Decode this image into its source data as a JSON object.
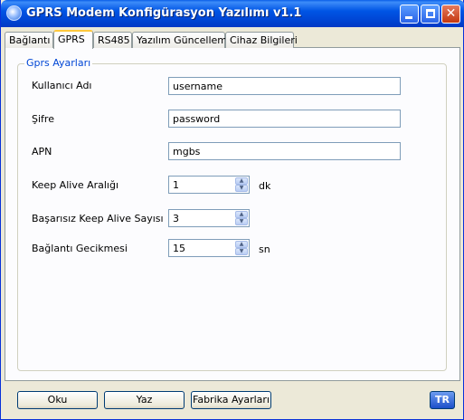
{
  "window": {
    "title": "GPRS Modem Konfigürasyon Yazılımı v1.1"
  },
  "tabs": [
    {
      "label": "Bağlantı"
    },
    {
      "label": "GPRS"
    },
    {
      "label": "RS485"
    },
    {
      "label": "Yazılım Güncelleme"
    },
    {
      "label": "Cihaz Bilgileri"
    }
  ],
  "group": {
    "title": "Gprs Ayarları"
  },
  "fields": {
    "username": {
      "label": "Kullanıcı Adı",
      "value": "username"
    },
    "password": {
      "label": "Şifre",
      "value": "password"
    },
    "apn": {
      "label": "APN",
      "value": "mgbs"
    },
    "keep_alive_interval": {
      "label": "Keep Alive Aralığı",
      "value": "1",
      "unit": "dk"
    },
    "failed_keep_alive_count": {
      "label": "Başarısız Keep Alive Sayısı",
      "value": "3"
    },
    "connection_delay": {
      "label": "Bağlantı Gecikmesi",
      "value": "15",
      "unit": "sn"
    }
  },
  "buttons": {
    "read": "Oku",
    "write": "Yaz",
    "factory": "Fabrika Ayarları",
    "language": "TR"
  },
  "colors": {
    "titlebar": "#0055e5",
    "group_title": "#0046d5",
    "active_tab_accent": "#ffc83c"
  }
}
